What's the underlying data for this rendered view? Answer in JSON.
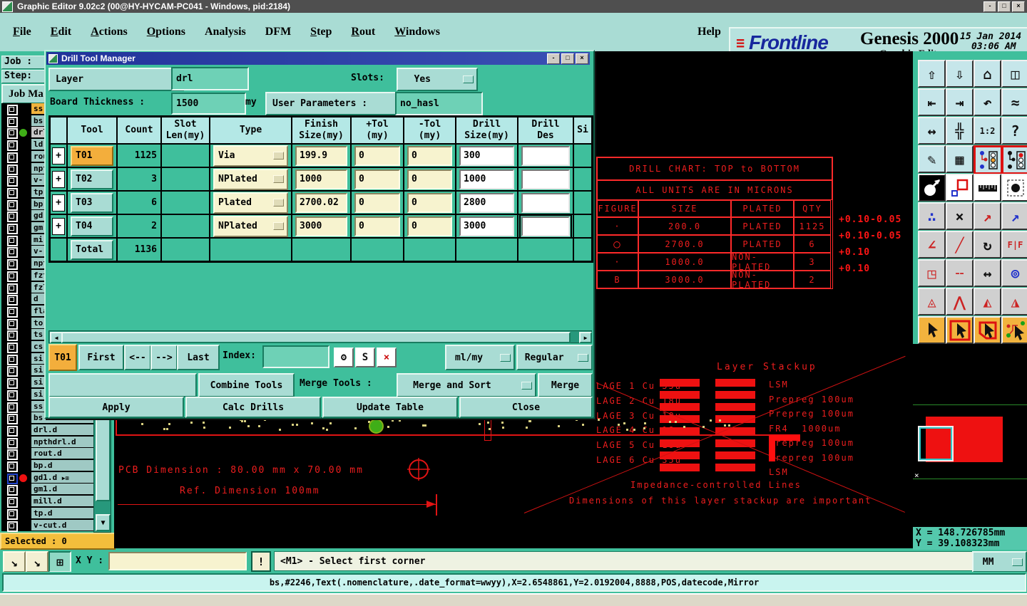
{
  "window": {
    "title": "Graphic Editor 9.02c2 (00@HY-HYCAM-PC041 - Windows, pid:2184)",
    "minimize": "-",
    "maximize": "□",
    "close": "×"
  },
  "menu": {
    "items": [
      {
        "label": "File",
        "accel": true
      },
      {
        "label": "Edit",
        "accel": true
      },
      {
        "label": "Actions",
        "accel": true
      },
      {
        "label": "Options",
        "accel": true
      },
      {
        "label": "Analysis",
        "accel": false
      },
      {
        "label": "DFM",
        "accel": false
      },
      {
        "label": "Step",
        "accel": true
      },
      {
        "label": "Rout",
        "accel": true
      },
      {
        "label": "Windows",
        "accel": true
      }
    ],
    "help": "Help"
  },
  "brand": {
    "speed_lines": "≡",
    "logo": "Frontline",
    "product": "Genesis 2000",
    "date": "15 Jan 2014",
    "time": "03:06 AM",
    "subtitle": "Graphic Editor"
  },
  "sidebar": {
    "job_label": "Job :",
    "step_label": "Step:",
    "job_matrix_label": "Job Ma",
    "selected_label": "Selected : 0",
    "layers": [
      {
        "name": "ss",
        "hl": "#f2b33e"
      },
      {
        "name": "bs"
      },
      {
        "name": "drl",
        "dot": "#3fae17",
        "hl": "#c9c9c9"
      },
      {
        "name": "ld"
      },
      {
        "name": "rou"
      },
      {
        "name": "npt"
      },
      {
        "name": "v-"
      },
      {
        "name": "tp"
      },
      {
        "name": "bp"
      },
      {
        "name": "gd"
      },
      {
        "name": "gm"
      },
      {
        "name": "mi"
      },
      {
        "name": "v-"
      },
      {
        "name": "npt"
      },
      {
        "name": "fzt"
      },
      {
        "name": "fzl"
      },
      {
        "name": "d"
      },
      {
        "name": "fla"
      },
      {
        "name": "to"
      },
      {
        "name": "ts"
      },
      {
        "name": "cs"
      },
      {
        "name": "si"
      },
      {
        "name": "si"
      },
      {
        "name": "si"
      },
      {
        "name": "si"
      },
      {
        "name": "ss"
      },
      {
        "name": "bs"
      },
      {
        "name": "drl.d"
      },
      {
        "name": "npthdrl.d"
      },
      {
        "name": "rout.d"
      },
      {
        "name": "bp.d"
      },
      {
        "name": "gd1.d",
        "dot": "#ee1111",
        "active": true
      },
      {
        "name": "gm1.d"
      },
      {
        "name": "mill.d"
      },
      {
        "name": "tp.d"
      },
      {
        "name": "v-cut.d"
      }
    ]
  },
  "dialog": {
    "title": "Drill Tool Manager",
    "layer_label": "Layer",
    "layer_colon": ":",
    "layer_value": "drl",
    "slots_label": "Slots:",
    "slots_value": "Yes",
    "board_label": "Board Thickness :",
    "board_value": "1500",
    "board_unit": "my",
    "user_params_label": "User Parameters :",
    "user_params_value": "no_hasl",
    "table": {
      "headers": [
        "",
        "Tool",
        "Count",
        "Slot\nLen(my)",
        "Type",
        "Finish\nSize(my)",
        "+Tol\n(my)",
        "-Tol\n(my)",
        "Drill\nSize(my)",
        "Drill\nDes",
        "Si"
      ],
      "rows": [
        {
          "tool": "T01",
          "count": "1125",
          "slot": "",
          "type": "Via",
          "finish": "199.9",
          "ptol": "0",
          "ntol": "0",
          "drill": "300",
          "des": "",
          "selected": true
        },
        {
          "tool": "T02",
          "count": "3",
          "slot": "",
          "type": "NPlated",
          "finish": "1000",
          "ptol": "0",
          "ntol": "0",
          "drill": "1000",
          "des": ""
        },
        {
          "tool": "T03",
          "count": "6",
          "slot": "",
          "type": "Plated",
          "finish": "2700.02",
          "ptol": "0",
          "ntol": "0",
          "drill": "2800",
          "des": ""
        },
        {
          "tool": "T04",
          "count": "2",
          "slot": "",
          "type": "NPlated",
          "finish": "3000",
          "ptol": "0",
          "ntol": "0",
          "drill": "3000",
          "des": "",
          "focus_des": true
        }
      ],
      "total_label": "Total",
      "total_count": "1136"
    },
    "nav": {
      "current": "T01",
      "first": "First",
      "prev": "<--",
      "next": "-->",
      "last": "Last",
      "index_label": "Index:",
      "index_value": "",
      "mini_buttons": [
        {
          "name": "highlight-tool-button",
          "glyph": "ʘ",
          "color": "#111"
        },
        {
          "name": "script-tool-button",
          "glyph": "S",
          "color": "#111"
        },
        {
          "name": "delete-tool-button",
          "glyph": "×",
          "color": "#cc1111"
        }
      ],
      "units_value": "ml/my",
      "mode_value": "Regular"
    },
    "merge": {
      "combine_label": "Combine Tools",
      "merge_tools_label": "Merge Tools :",
      "merge_mode_value": "Merge and Sort",
      "merge_button_label": "Merge"
    },
    "actions": [
      "Apply",
      "Calc Drills",
      "Update Table",
      "Close"
    ]
  },
  "canvas": {
    "drill_chart": {
      "title": "DRILL CHART: TOP to BOTTOM",
      "subtitle": "ALL UNITS ARE IN MICRONS",
      "headers": [
        "FIGURE",
        "SIZE",
        "PLATED",
        "QTY"
      ],
      "rows": [
        {
          "figure": "·",
          "size": "200.0",
          "plated": "PLATED",
          "qty": "1125",
          "tol": "+0.10-0.05"
        },
        {
          "figure": "○",
          "size": "2700.0",
          "plated": "PLATED",
          "qty": "6",
          "tol": "+0.10-0.05"
        },
        {
          "figure": "·",
          "size": "1000.0",
          "plated": "NON-PLATED",
          "qty": "3",
          "tol": "+0.10"
        },
        {
          "figure": "B",
          "size": "3000.0",
          "plated": "NON-PLATED",
          "qty": "2",
          "tol": "+0.10"
        }
      ]
    },
    "stackup": {
      "title": "Layer Stackup",
      "left_labels": [
        "LAGE 1 Cu 35u",
        "LAGE 2 Cu 18u",
        "LAGE 3 Cu 18u",
        "LAGE 4 Cu 18u",
        "LAGE 5 Cu 18u",
        "LAGE 6 Cu 35u"
      ],
      "right_labels": [
        "LSM",
        "Prepreg 100um",
        "Prepreg 100um",
        "FR4  1000um",
        "Prepreg 100um",
        "Prepreg 100um",
        "LSM"
      ],
      "note1": "Impedance-controlled Lines",
      "note2": "Dimensions of this layer stackup are important"
    },
    "pcb_dim_text": "PCB Dimension : 80.00 mm x 70.00 mm",
    "ref_dim_text": "Ref. Dimension 100mm"
  },
  "overview": {
    "x_coord": "X = 148.726785mm",
    "y_coord": "Y = 39.108323mm"
  },
  "bottombar": {
    "buttons": [
      {
        "name": "snap-mode-button",
        "glyph": "↘"
      },
      {
        "name": "snap-angle-button",
        "glyph": "↘"
      },
      {
        "name": "grid-toggle-button",
        "glyph": "⊞"
      }
    ],
    "xy_label": "X Y :",
    "xy_value": "",
    "alert_label": "!",
    "prompt": "<M1> - Select first corner",
    "units_value": "MM"
  },
  "statusline": {
    "message": "bs,#2246,Text(.nomenclature,.date_format=wwyy),X=2.6548861,Y=2.0192004,8888,POS,datecode,Mirror"
  },
  "toolbar": {
    "buttons": [
      {
        "name": "copy-up-icon",
        "glyph": "⇧"
      },
      {
        "name": "copy-down-icon",
        "glyph": "⇩"
      },
      {
        "name": "home-view-icon",
        "glyph": "⌂"
      },
      {
        "name": "tile-windows-icon",
        "glyph": "◫"
      },
      {
        "name": "pan-left-icon",
        "glyph": "⇤"
      },
      {
        "name": "pan-right-icon",
        "glyph": "⇥"
      },
      {
        "name": "previous-view-icon",
        "glyph": "↶"
      },
      {
        "name": "s-route-icon",
        "glyph": "≈"
      },
      {
        "name": "fit-view-icon",
        "glyph": "↔"
      },
      {
        "name": "center-object-icon",
        "glyph": "╬"
      },
      {
        "name": "zoom-ratio-button",
        "glyph": "1:2",
        "fs": 12
      },
      {
        "name": "what-is-help-icon",
        "glyph": "?"
      },
      {
        "name": "settings-tools-icon",
        "glyph": "✎"
      },
      {
        "name": "grid-settings-icon",
        "glyph": "▦"
      },
      {
        "name": "layer-signals-icon",
        "svg": "traffic1",
        "frame": "#dd1111",
        "bg": "#c6e2e8"
      },
      {
        "name": "layer-signals-alt-icon",
        "svg": "traffic2",
        "frame": "#dd1111",
        "bg": "#c6e2e8"
      },
      {
        "name": "pad-view-icon",
        "svg": "circleArrow",
        "bg": "#000"
      },
      {
        "name": "zoom-window-icon",
        "svg": "zoomRects",
        "bg": "#fff"
      },
      {
        "name": "measure-ruler-icon",
        "svg": "ruler",
        "bg": "#fff"
      },
      {
        "name": "dot-select-icon",
        "svg": "dashedDot",
        "bg": "#fff"
      },
      {
        "name": "chain-select-icon",
        "glyph": "∴",
        "color": "#2233cc"
      },
      {
        "name": "unselect-icon",
        "glyph": "×",
        "color": "#111"
      },
      {
        "name": "move-to-icon",
        "glyph": "↗",
        "color": "#cc2222"
      },
      {
        "name": "copy-to-icon",
        "glyph": "↗",
        "color": "#2233cc"
      },
      {
        "name": "angle-measure-icon",
        "glyph": "∠",
        "color": "#cc2222"
      },
      {
        "name": "slant-line-icon",
        "glyph": "╱",
        "color": "#cc2222"
      },
      {
        "name": "rotate-icon",
        "glyph": "↻",
        "color": "#111"
      },
      {
        "name": "mirror-icon",
        "glyph": "F|F",
        "color": "#cc2222",
        "fs": 12
      },
      {
        "name": "copy-pad-icon",
        "glyph": "◳",
        "color": "#cc2222"
      },
      {
        "name": "dashed-line-icon",
        "glyph": "╌",
        "color": "#cc2222"
      },
      {
        "name": "measure-gap-icon",
        "glyph": "↔",
        "color": "#111"
      },
      {
        "name": "overlap-shapes-icon",
        "glyph": "⊚",
        "color": "#2233cc"
      },
      {
        "name": "peak-small-icon",
        "glyph": "◬",
        "color": "#cc2222"
      },
      {
        "name": "peak-outline-icon",
        "glyph": "⋀",
        "color": "#cc2222"
      },
      {
        "name": "peak-baseline-icon",
        "glyph": "◭",
        "color": "#cc2222"
      },
      {
        "name": "peak-dashed-icon",
        "glyph": "◮",
        "color": "#cc2222"
      },
      {
        "name": "select-mode-icon",
        "svg": "cursor"
      },
      {
        "name": "select-window-icon",
        "svg": "cursorFrame"
      },
      {
        "name": "select-polygon-icon",
        "svg": "cursorRound"
      },
      {
        "name": "select-net-icon",
        "svg": "cursorNet"
      }
    ]
  }
}
